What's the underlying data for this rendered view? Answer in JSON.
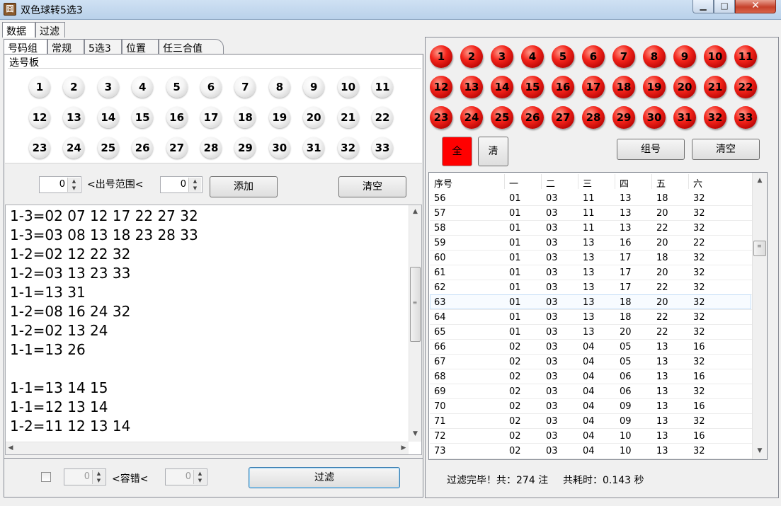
{
  "window": {
    "title": "双色球转5选3",
    "close_glyph": "✕",
    "min_glyph": "▁",
    "max_glyph": "□"
  },
  "top_tabs": [
    "数据",
    "过滤"
  ],
  "sub_tabs": [
    "号码组",
    "常规",
    "5选3",
    "位置",
    "任三合值"
  ],
  "select_board": {
    "label": "选号板",
    "numbers": [
      "1",
      "2",
      "3",
      "4",
      "5",
      "6",
      "7",
      "8",
      "9",
      "10",
      "11",
      "12",
      "13",
      "14",
      "15",
      "16",
      "17",
      "18",
      "19",
      "20",
      "21",
      "22",
      "23",
      "24",
      "25",
      "26",
      "27",
      "28",
      "29",
      "30",
      "31",
      "32",
      "33"
    ]
  },
  "range": {
    "from_value": "0",
    "label": "<出号范围<",
    "to_value": "0",
    "add_label": "添加",
    "clear_label": "清空"
  },
  "memo_lines": [
    "1-3=02 07 12 17 22 27 32",
    "1-3=03 08 13 18 23 28 33",
    "1-2=02 12 22 32",
    "1-2=03 13 23 33",
    "1-1=13 31",
    "1-2=08 16 24 32",
    "1-2=02 13 24",
    "1-1=13 26",
    "",
    "1-1=13 14 15",
    "1-1=12 13 14",
    "1-2=11 12 13 14"
  ],
  "filter_bar": {
    "from_value": "0",
    "label": "<容错<",
    "to_value": "0",
    "filter_label": "过滤"
  },
  "red_balls": [
    "1",
    "2",
    "3",
    "4",
    "5",
    "6",
    "7",
    "8",
    "9",
    "10",
    "11",
    "12",
    "13",
    "14",
    "15",
    "16",
    "17",
    "18",
    "19",
    "20",
    "21",
    "22",
    "23",
    "24",
    "25",
    "26",
    "27",
    "28",
    "29",
    "30",
    "31",
    "32",
    "33"
  ],
  "right_buttons": {
    "all_label": "全",
    "clear_small_label": "清",
    "group_label": "组号",
    "clear_label": "清空",
    "all_color": "#ff0000"
  },
  "table": {
    "headers": [
      "序号",
      "一",
      "二",
      "三",
      "四",
      "五",
      "六"
    ],
    "selected_row": "63",
    "rows": [
      [
        "56",
        "01",
        "03",
        "11",
        "13",
        "18",
        "32"
      ],
      [
        "57",
        "01",
        "03",
        "11",
        "13",
        "20",
        "32"
      ],
      [
        "58",
        "01",
        "03",
        "11",
        "13",
        "22",
        "32"
      ],
      [
        "59",
        "01",
        "03",
        "13",
        "16",
        "20",
        "22"
      ],
      [
        "60",
        "01",
        "03",
        "13",
        "17",
        "18",
        "32"
      ],
      [
        "61",
        "01",
        "03",
        "13",
        "17",
        "20",
        "32"
      ],
      [
        "62",
        "01",
        "03",
        "13",
        "17",
        "22",
        "32"
      ],
      [
        "63",
        "01",
        "03",
        "13",
        "18",
        "20",
        "32"
      ],
      [
        "64",
        "01",
        "03",
        "13",
        "18",
        "22",
        "32"
      ],
      [
        "65",
        "01",
        "03",
        "13",
        "20",
        "22",
        "32"
      ],
      [
        "66",
        "02",
        "03",
        "04",
        "05",
        "13",
        "16"
      ],
      [
        "67",
        "02",
        "03",
        "04",
        "05",
        "13",
        "32"
      ],
      [
        "68",
        "02",
        "03",
        "04",
        "06",
        "13",
        "16"
      ],
      [
        "69",
        "02",
        "03",
        "04",
        "06",
        "13",
        "32"
      ],
      [
        "70",
        "02",
        "03",
        "04",
        "09",
        "13",
        "16"
      ],
      [
        "71",
        "02",
        "03",
        "04",
        "09",
        "13",
        "32"
      ],
      [
        "72",
        "02",
        "03",
        "04",
        "10",
        "13",
        "16"
      ],
      [
        "73",
        "02",
        "03",
        "04",
        "10",
        "13",
        "32"
      ]
    ]
  },
  "status": {
    "done_text": "过滤完毕！共：274 注",
    "time_text": "共耗时：0.143 秒"
  }
}
